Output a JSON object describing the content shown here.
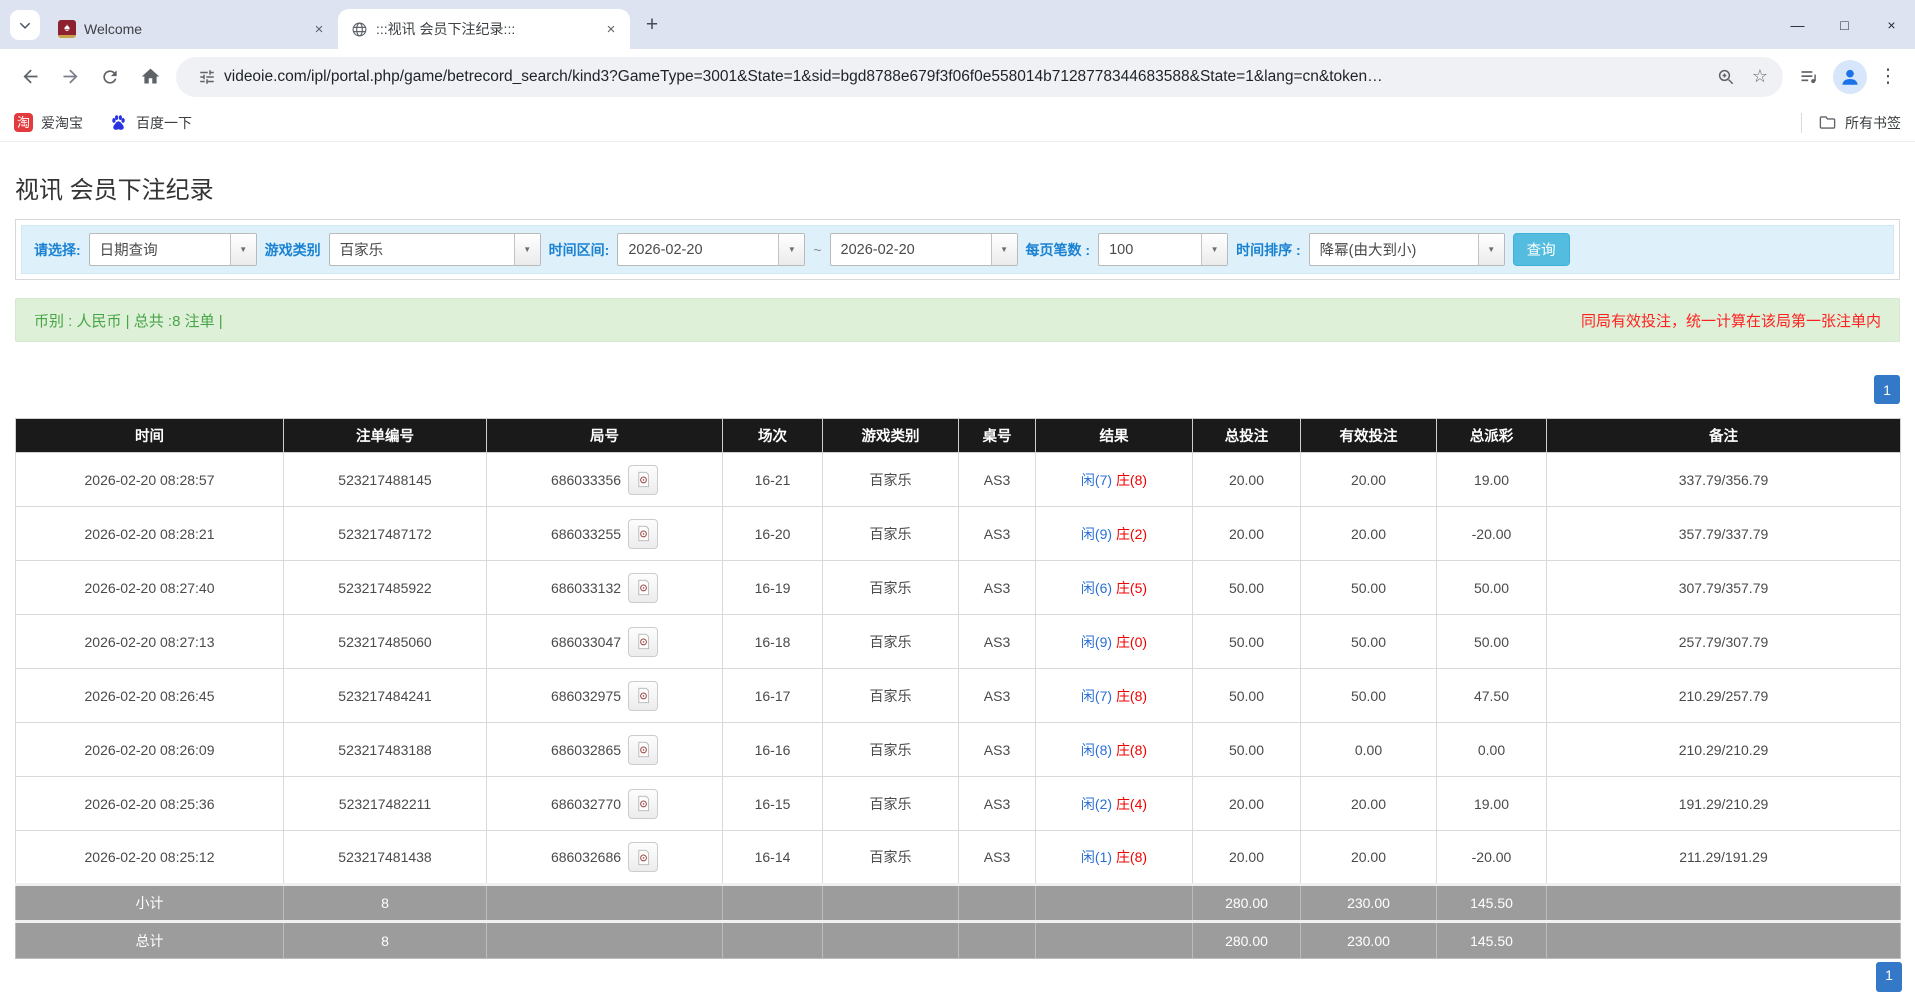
{
  "browser": {
    "tabs": [
      {
        "title": "Welcome"
      },
      {
        "title": ":::视讯 会员下注纪录:::"
      }
    ],
    "url": "videoie.com/ipl/portal.php/game/betrecord_search/kind3?GameType=3001&State=1&sid=bgd8788e679f3f06f0e558014b7128778344683588&State=1&lang=cn&token…",
    "bookmarks": [
      {
        "label": "爱淘宝"
      },
      {
        "label": "百度一下"
      }
    ],
    "all_bookmarks_label": "所有书签"
  },
  "icons": {
    "close": "×",
    "plus": "+",
    "minimize": "—",
    "maximize": "□",
    "window_close": "×",
    "dots": "⋮",
    "star": "☆",
    "select_arrow": "▼",
    "taobao_char": "淘",
    "poker_char": "♠"
  },
  "page": {
    "title": "视讯 会员下注纪录",
    "filters": {
      "select_label": "请选择:",
      "select_value": "日期查询",
      "game_type_label": "游戏类别",
      "game_type_value": "百家乐",
      "period_label": "时间区间:",
      "date_from": "2026-02-20",
      "tilde": "~",
      "date_to": "2026-02-20",
      "page_size_label": "每页笔数 :",
      "page_size_value": "100",
      "sort_label": "时间排序 :",
      "sort_value": "降幂(由大到小)",
      "search_button": "查询"
    },
    "summary": {
      "left": "币别 : 人民币 | 总共 :8 注单 |",
      "right": "同局有效投注，统一计算在该局第一张注单内"
    },
    "pagination": "1"
  },
  "table": {
    "headers": [
      "时间",
      "注单编号",
      "局号",
      "场次",
      "游戏类别",
      "桌号",
      "结果",
      "总投注",
      "有效投注",
      "总派彩",
      "备注"
    ],
    "rows": [
      {
        "time": "2026-02-20 08:28:57",
        "bet_id": "523217488145",
        "round": "686033356",
        "session": "16-21",
        "game": "百家乐",
        "table": "AS3",
        "player": "闲(7)",
        "banker": "庄(8)",
        "total_bet": "20.00",
        "valid_bet": "20.00",
        "payout": "19.00",
        "note": "337.79/356.79"
      },
      {
        "time": "2026-02-20 08:28:21",
        "bet_id": "523217487172",
        "round": "686033255",
        "session": "16-20",
        "game": "百家乐",
        "table": "AS3",
        "player": "闲(9)",
        "banker": "庄(2)",
        "total_bet": "20.00",
        "valid_bet": "20.00",
        "payout": "-20.00",
        "note": "357.79/337.79"
      },
      {
        "time": "2026-02-20 08:27:40",
        "bet_id": "523217485922",
        "round": "686033132",
        "session": "16-19",
        "game": "百家乐",
        "table": "AS3",
        "player": "闲(6)",
        "banker": "庄(5)",
        "total_bet": "50.00",
        "valid_bet": "50.00",
        "payout": "50.00",
        "note": "307.79/357.79"
      },
      {
        "time": "2026-02-20 08:27:13",
        "bet_id": "523217485060",
        "round": "686033047",
        "session": "16-18",
        "game": "百家乐",
        "table": "AS3",
        "player": "闲(9)",
        "banker": "庄(0)",
        "total_bet": "50.00",
        "valid_bet": "50.00",
        "payout": "50.00",
        "note": "257.79/307.79"
      },
      {
        "time": "2026-02-20 08:26:45",
        "bet_id": "523217484241",
        "round": "686032975",
        "session": "16-17",
        "game": "百家乐",
        "table": "AS3",
        "player": "闲(7)",
        "banker": "庄(8)",
        "total_bet": "50.00",
        "valid_bet": "50.00",
        "payout": "47.50",
        "note": "210.29/257.79"
      },
      {
        "time": "2026-02-20 08:26:09",
        "bet_id": "523217483188",
        "round": "686032865",
        "session": "16-16",
        "game": "百家乐",
        "table": "AS3",
        "player": "闲(8)",
        "banker": "庄(8)",
        "total_bet": "50.00",
        "valid_bet": "0.00",
        "payout": "0.00",
        "note": "210.29/210.29"
      },
      {
        "time": "2026-02-20 08:25:36",
        "bet_id": "523217482211",
        "round": "686032770",
        "session": "16-15",
        "game": "百家乐",
        "table": "AS3",
        "player": "闲(2)",
        "banker": "庄(4)",
        "total_bet": "20.00",
        "valid_bet": "20.00",
        "payout": "19.00",
        "note": "191.29/210.29"
      },
      {
        "time": "2026-02-20 08:25:12",
        "bet_id": "523217481438",
        "round": "686032686",
        "session": "16-14",
        "game": "百家乐",
        "table": "AS3",
        "player": "闲(1)",
        "banker": "庄(8)",
        "total_bet": "20.00",
        "valid_bet": "20.00",
        "payout": "-20.00",
        "note": "211.29/191.29"
      }
    ],
    "subtotal": {
      "label": "小计",
      "count": "8",
      "total_bet": "280.00",
      "valid_bet": "230.00",
      "payout": "145.50"
    },
    "total": {
      "label": "总计",
      "count": "8",
      "total_bet": "280.00",
      "valid_bet": "230.00",
      "payout": "145.50"
    }
  }
}
